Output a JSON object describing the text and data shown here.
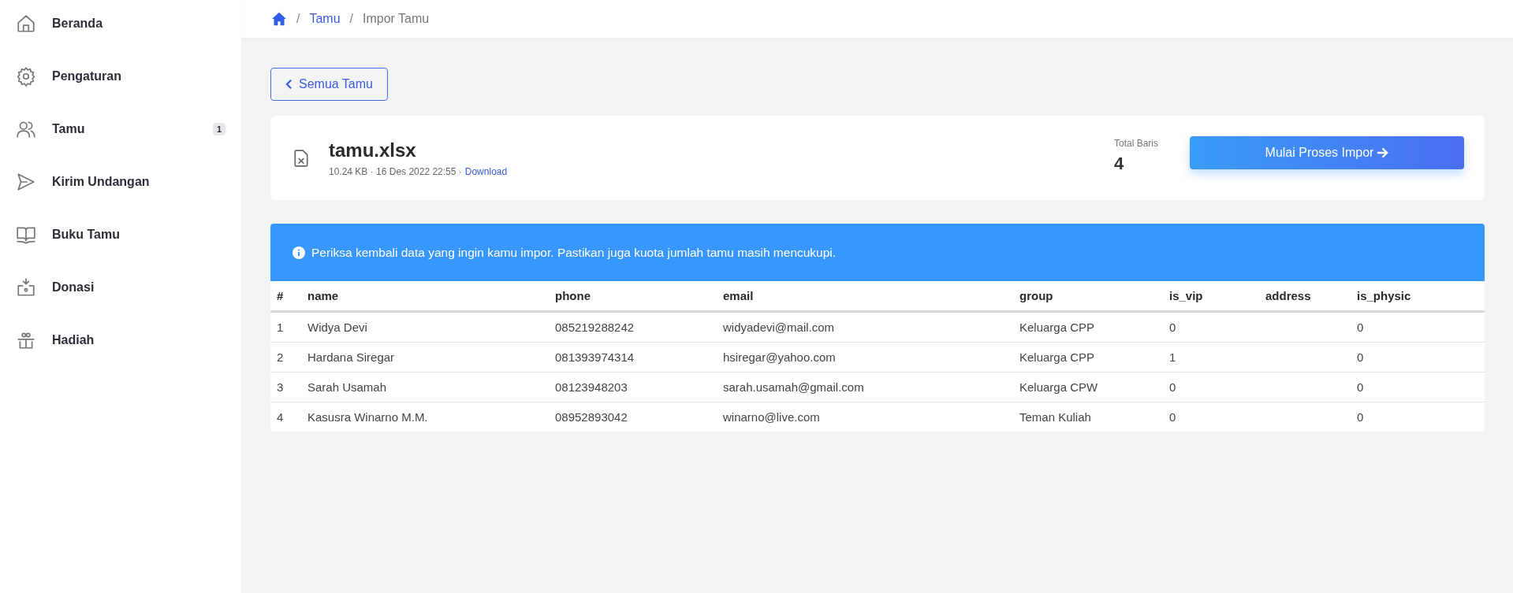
{
  "sidebar": {
    "items": [
      {
        "label": "Beranda"
      },
      {
        "label": "Pengaturan"
      },
      {
        "label": "Tamu",
        "badge": "1"
      },
      {
        "label": "Kirim Undangan"
      },
      {
        "label": "Buku Tamu"
      },
      {
        "label": "Donasi"
      },
      {
        "label": "Hadiah"
      }
    ]
  },
  "breadcrumb": {
    "items": [
      {
        "separator": "/",
        "label": "Tamu",
        "kind": "link"
      },
      {
        "separator": "/",
        "label": "Impor Tamu",
        "kind": "current"
      }
    ]
  },
  "back_button": {
    "label": "Semua Tamu"
  },
  "file": {
    "name": "tamu.xlsx",
    "meta": "10.24 KB · 16 Des 2022 22:55 ·",
    "link": "Download"
  },
  "total": {
    "label": "Total Baris",
    "value": "4"
  },
  "start_button": {
    "label": "Mulai Proses Impor"
  },
  "alert": {
    "text": "Periksa kembali data yang ingin kamu impor. Pastikan juga kuota jumlah tamu masih mencukupi."
  },
  "table": {
    "columns": [
      "#",
      "name",
      "phone",
      "email",
      "group",
      "is_vip",
      "address",
      "is_physic"
    ],
    "rows": [
      [
        "1",
        "Widya Devi",
        "085219288242",
        "widyadevi@mail.com",
        "Keluarga CPP",
        "0",
        "",
        "0"
      ],
      [
        "2",
        "Hardana Siregar",
        "081393974314",
        "hsiregar@yahoo.com",
        "Keluarga CPP",
        "1",
        "",
        "0"
      ],
      [
        "3",
        "Sarah Usamah",
        "08123948203",
        "sarah.usamah@gmail.com",
        "Keluarga CPW",
        "0",
        "",
        "0"
      ],
      [
        "4",
        "Kasusra Winarno M.M.",
        "08952893042",
        "winarno@live.com",
        "Teman Kuliah",
        "0",
        "",
        "0"
      ]
    ]
  }
}
